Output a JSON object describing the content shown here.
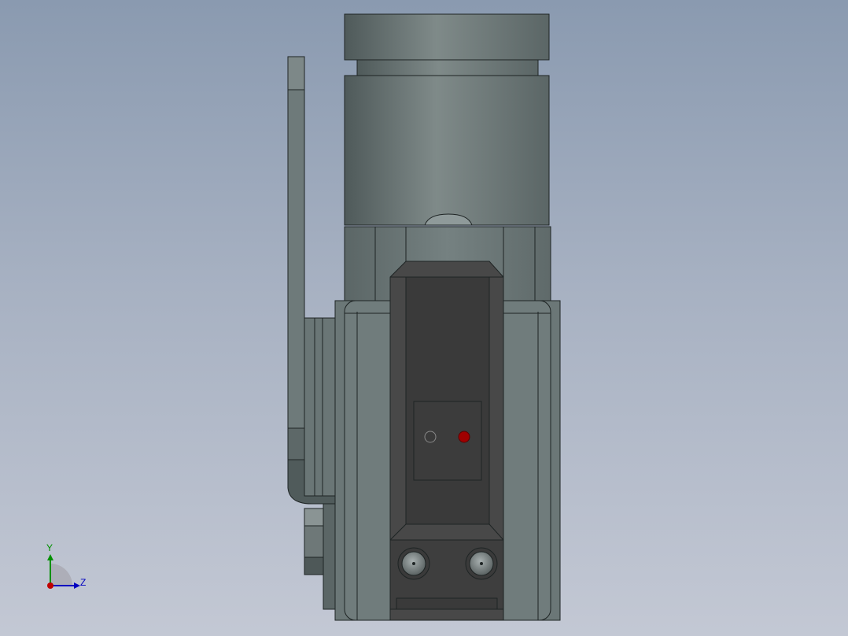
{
  "viewport": {
    "background_top": "#8a9ab0",
    "background_bottom": "#c3c8d4"
  },
  "model": {
    "body_color": "#6e7a7a",
    "edge_color": "#1e2424",
    "dark_panel_color": "#3a3a3a",
    "indicator_off_color": "#3a3a3a",
    "indicator_on_color": "#a00000"
  },
  "triad": {
    "x_axis_color": "#c00000",
    "y_axis_color": "#009000",
    "z_axis_color": "#0000c0",
    "y_label": "Y",
    "z_label": "Z"
  }
}
